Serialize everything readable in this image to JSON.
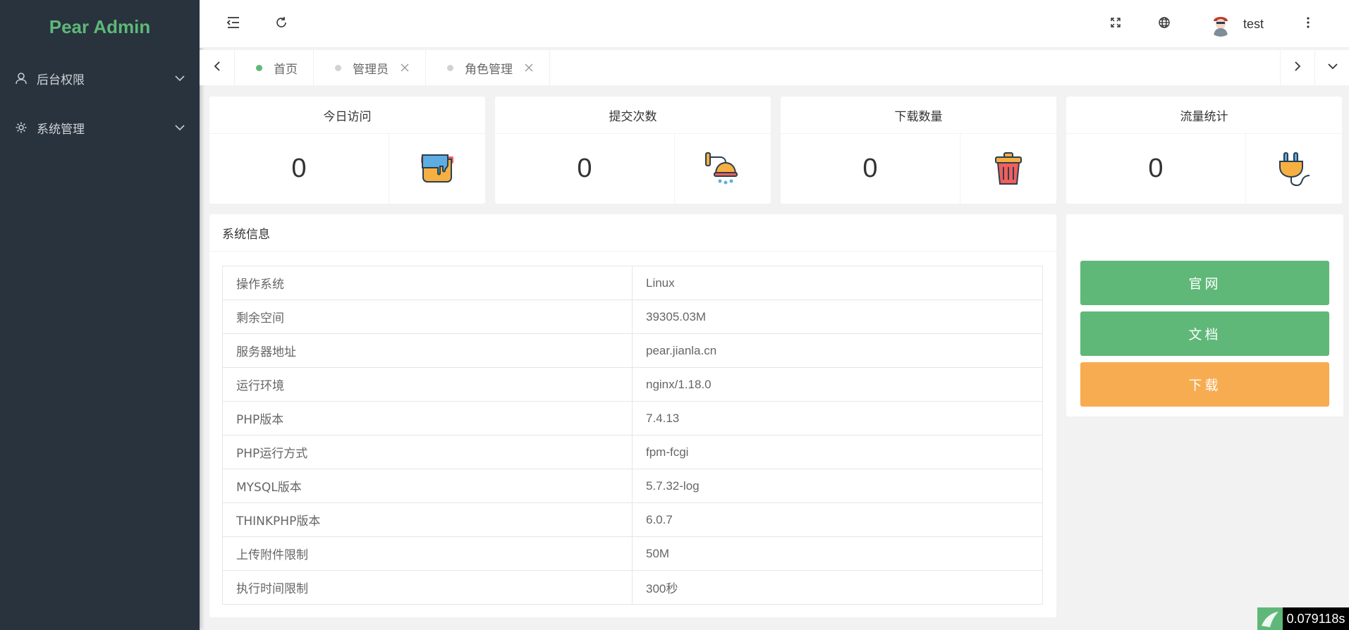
{
  "sidebar": {
    "logo": "Pear Admin",
    "items": [
      {
        "label": "后台权限",
        "icon": "user-icon"
      },
      {
        "label": "系统管理",
        "icon": "gear-icon"
      }
    ]
  },
  "header": {
    "username": "test",
    "icons": [
      "menu-fold-icon",
      "refresh-icon",
      "fullscreen-icon",
      "globe-icon",
      "more-vertical-icon"
    ]
  },
  "tabs": [
    {
      "label": "首页",
      "active": true,
      "closable": false
    },
    {
      "label": "管理员",
      "active": false,
      "closable": true
    },
    {
      "label": "角色管理",
      "active": false,
      "closable": true
    }
  ],
  "stats": [
    {
      "title": "今日访问",
      "value": "0",
      "icon": "paint-bucket-icon"
    },
    {
      "title": "提交次数",
      "value": "0",
      "icon": "shower-icon"
    },
    {
      "title": "下载数量",
      "value": "0",
      "icon": "trash-bin-icon"
    },
    {
      "title": "流量统计",
      "value": "0",
      "icon": "plug-icon"
    }
  ],
  "system_info": {
    "title": "系统信息",
    "rows": [
      {
        "key": "操作系统",
        "value": "Linux"
      },
      {
        "key": "剩余空间",
        "value": "39305.03M"
      },
      {
        "key": "服务器地址",
        "value": "pear.jianla.cn"
      },
      {
        "key": "运行环境",
        "value": "nginx/1.18.0"
      },
      {
        "key": "PHP版本",
        "value": "7.4.13"
      },
      {
        "key": "PHP运行方式",
        "value": "fpm-fcgi"
      },
      {
        "key": "MYSQL版本",
        "value": "5.7.32-log"
      },
      {
        "key": "THINKPHP版本",
        "value": "6.0.7"
      },
      {
        "key": "上传附件限制",
        "value": "50M"
      },
      {
        "key": "执行时间限制",
        "value": "300秒"
      }
    ]
  },
  "links": [
    {
      "label": "官网",
      "color": "#5fb878"
    },
    {
      "label": "文档",
      "color": "#5fb878"
    },
    {
      "label": "下载",
      "color": "#f7ac51"
    }
  ],
  "timer": "0.079118s"
}
